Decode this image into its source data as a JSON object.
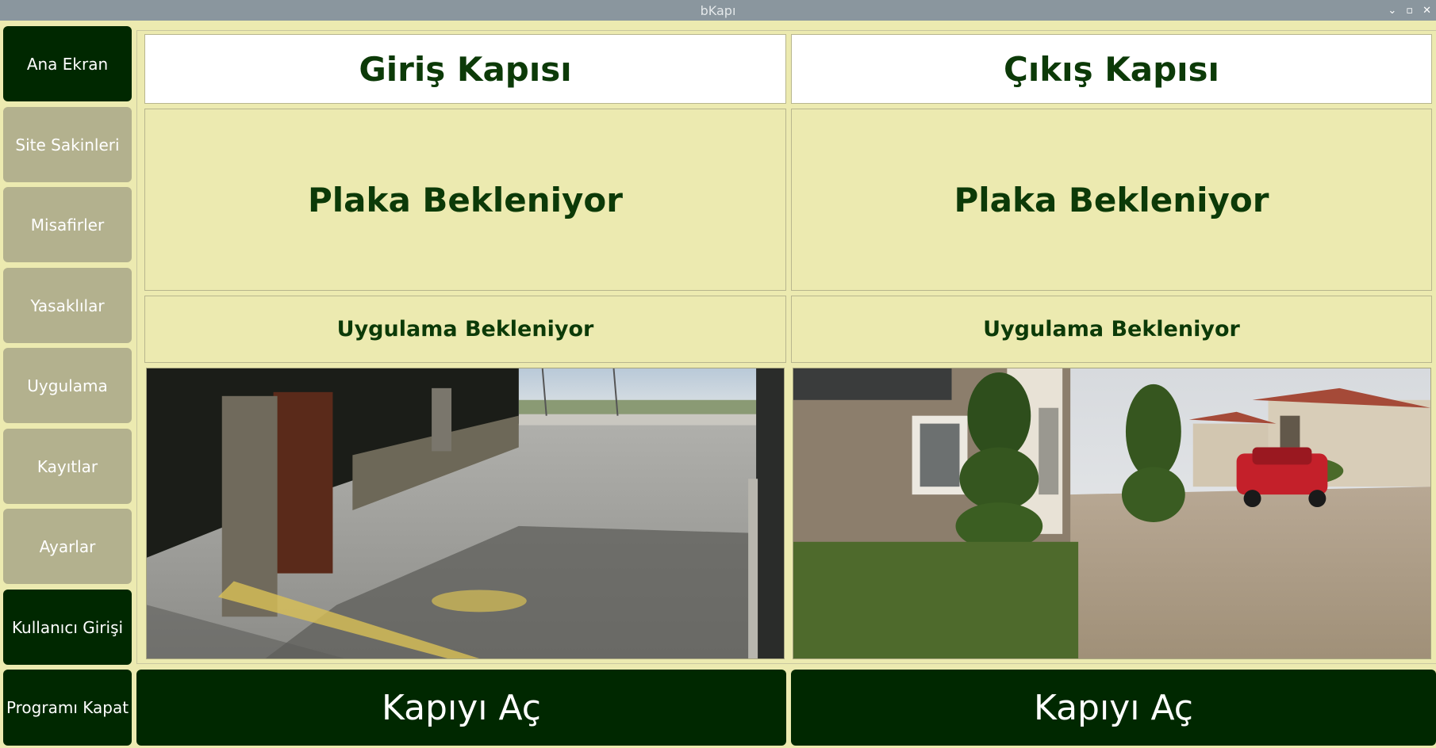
{
  "window": {
    "title": "bKapı",
    "controls": {
      "minimize": "⌄",
      "maximize": "▫",
      "close": "✕"
    }
  },
  "sidebar": {
    "items": [
      {
        "label": "Ana Ekran",
        "style": "dark"
      },
      {
        "label": "Site Sakinleri",
        "style": "tan"
      },
      {
        "label": "Misafirler",
        "style": "tan"
      },
      {
        "label": "Yasaklılar",
        "style": "tan"
      },
      {
        "label": "Uygulama",
        "style": "tan"
      },
      {
        "label": "Kayıtlar",
        "style": "tan"
      },
      {
        "label": "Ayarlar",
        "style": "tan"
      },
      {
        "label": "Kullanıcı Girişi",
        "style": "dark"
      },
      {
        "label": "Programı Kapat",
        "style": "dark"
      }
    ]
  },
  "gates": [
    {
      "title": "Giriş Kapısı",
      "plate_status": "Plaka Bekleniyor",
      "app_status": "Uygulama Bekleniyor",
      "camera": "entrance-camera-feed",
      "open_label": "Kapıyı Aç"
    },
    {
      "title": "Çıkış Kapısı",
      "plate_status": "Plaka Bekleniyor",
      "app_status": "Uygulama Bekleniyor",
      "camera": "exit-camera-feed",
      "open_label": "Kapıyı Aç"
    }
  ],
  "colors": {
    "background": "#eceab0",
    "dark_button": "#002800",
    "tan_button": "#b3b18e",
    "text_green": "#0c3a08",
    "titlebar": "#8a969e"
  }
}
